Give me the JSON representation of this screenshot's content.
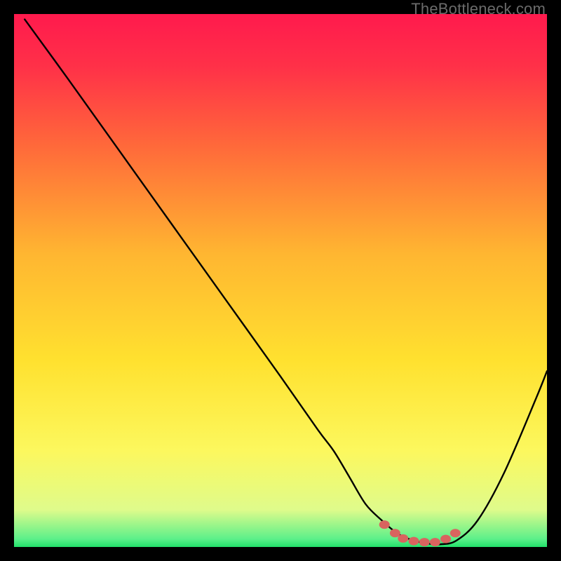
{
  "watermark": "TheBottleneck.com",
  "chart_data": {
    "type": "line",
    "title": "",
    "xlabel": "",
    "ylabel": "",
    "xlim": [
      0,
      100
    ],
    "ylim": [
      0,
      100
    ],
    "grid": false,
    "legend": false,
    "series": [
      {
        "name": "bottleneck-curve",
        "color": "#000000",
        "x": [
          2,
          10,
          20,
          30,
          40,
          50,
          57,
          60,
          63,
          66,
          69,
          72,
          75,
          78,
          80,
          83,
          87,
          92,
          98,
          100
        ],
        "y": [
          99,
          88,
          74,
          60,
          46,
          32,
          22,
          18,
          13,
          8,
          5,
          2.5,
          1.2,
          0.6,
          0.5,
          1.2,
          5,
          14,
          28,
          33
        ]
      }
    ],
    "markers": {
      "name": "optimal-range-dots",
      "color": "#d9645f",
      "x": [
        69.5,
        71.5,
        73.0,
        75.0,
        77.0,
        79.0,
        81.0,
        82.8
      ],
      "y": [
        4.2,
        2.6,
        1.6,
        1.1,
        0.9,
        0.9,
        1.5,
        2.6
      ]
    },
    "gradient_stops": [
      {
        "offset": 0.0,
        "color": "#ff1a4d"
      },
      {
        "offset": 0.1,
        "color": "#ff3148"
      },
      {
        "offset": 0.25,
        "color": "#ff6a3a"
      },
      {
        "offset": 0.45,
        "color": "#ffb631"
      },
      {
        "offset": 0.65,
        "color": "#ffe12f"
      },
      {
        "offset": 0.82,
        "color": "#fcf85e"
      },
      {
        "offset": 0.93,
        "color": "#dffb8b"
      },
      {
        "offset": 0.985,
        "color": "#5cf08a"
      },
      {
        "offset": 1.0,
        "color": "#22e06a"
      }
    ]
  }
}
